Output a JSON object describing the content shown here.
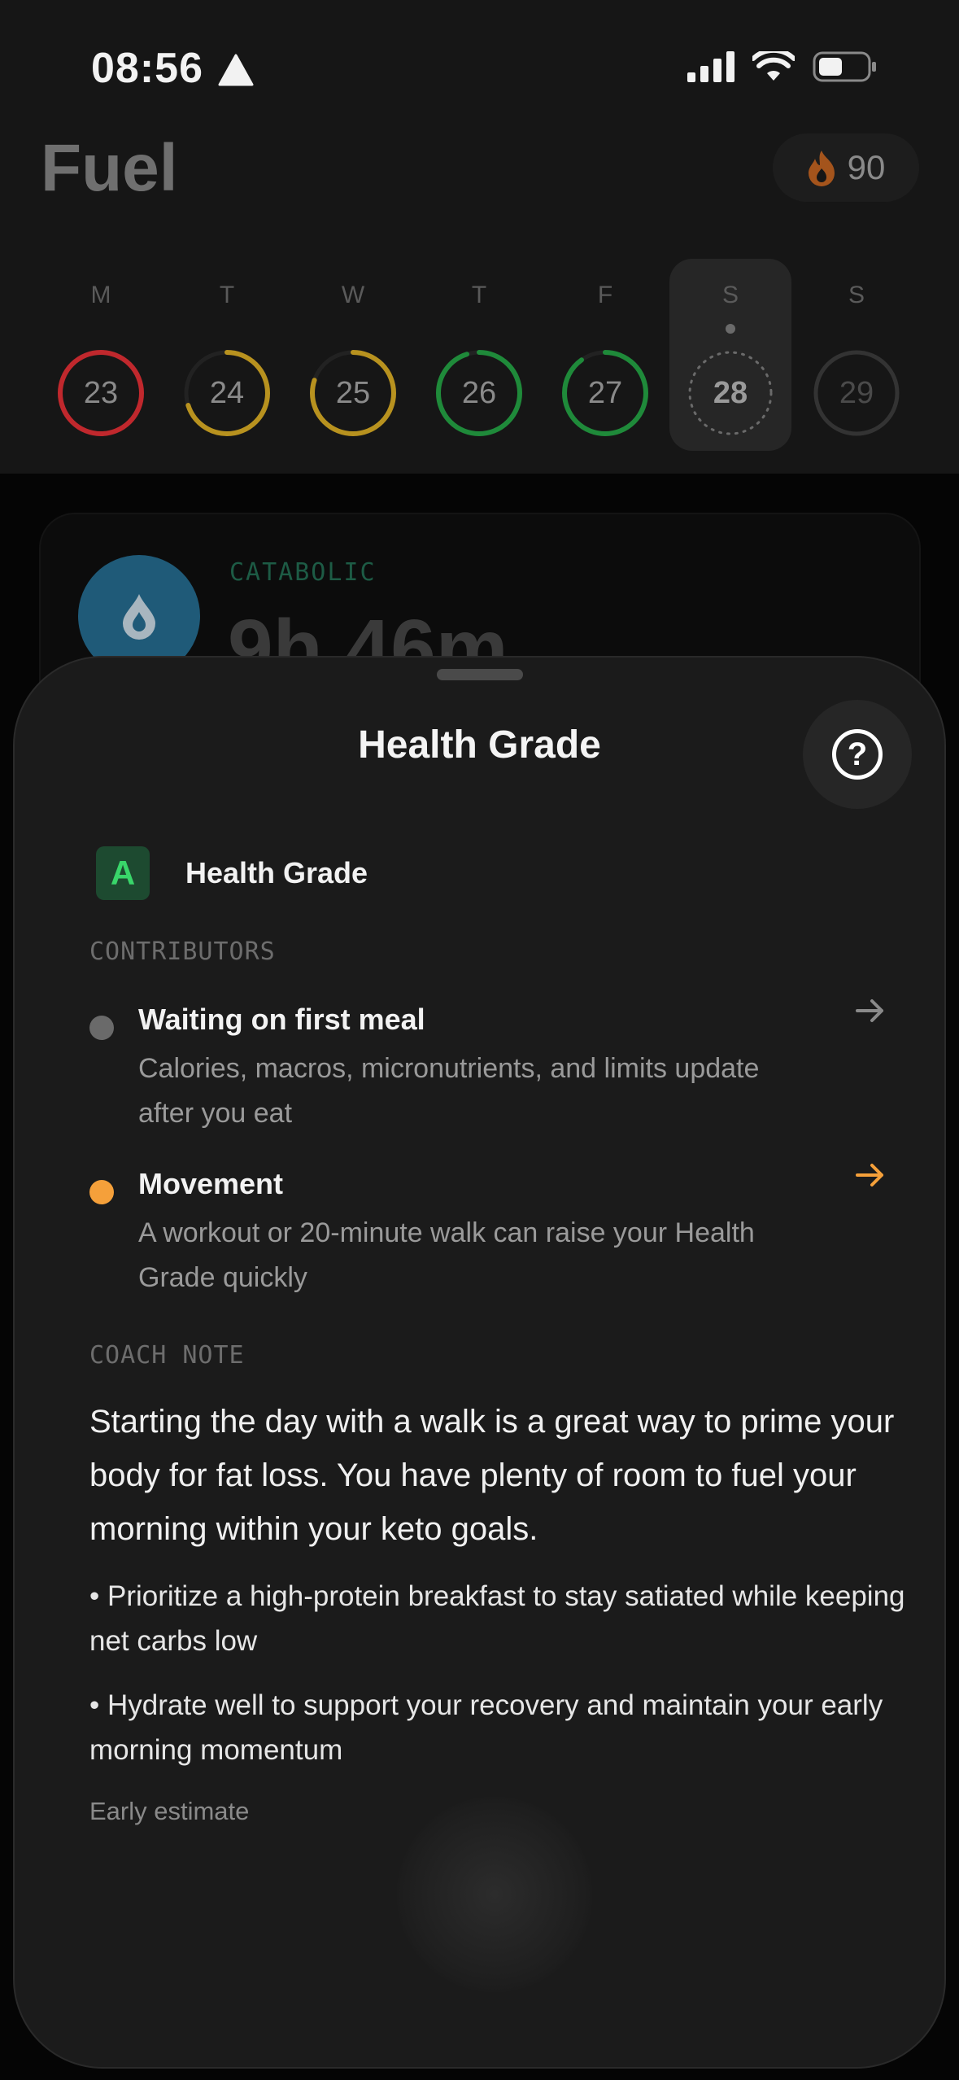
{
  "status_bar": {
    "time": "08:56"
  },
  "app": {
    "title": "Fuel",
    "streak_value": "90"
  },
  "week": [
    {
      "letter": "M",
      "day": "23",
      "ring_color": "#c0282d",
      "progress": 1.0
    },
    {
      "letter": "T",
      "day": "24",
      "ring_color": "#b8921f",
      "progress": 0.7
    },
    {
      "letter": "W",
      "day": "25",
      "ring_color": "#b8921f",
      "progress": 0.8
    },
    {
      "letter": "T",
      "day": "26",
      "ring_color": "#1f8a3a",
      "progress": 0.95
    },
    {
      "letter": "F",
      "day": "27",
      "ring_color": "#1f8a3a",
      "progress": 0.9
    },
    {
      "letter": "S",
      "day": "28",
      "ring_color": "#8a8a8a",
      "progress": 0,
      "selected": true
    },
    {
      "letter": "S",
      "day": "29",
      "ring_color": "#333333",
      "progress": 0
    }
  ],
  "fast_card": {
    "phase": "CATABOLIC",
    "elapsed": "9h 46m"
  },
  "sheet": {
    "title": "Health Grade",
    "grade_letter": "A",
    "grade_label": "Health Grade",
    "contributors_label": "CONTRIBUTORS",
    "contributors": [
      {
        "title": "Waiting on first meal",
        "description": "Calories, macros, micronutrients, and limits update after you eat",
        "dot_color": "#6a6a6a",
        "arrow_color": "#8a8a8a"
      },
      {
        "title": "Movement",
        "description": "A workout or 20-minute walk can raise your Health Grade quickly",
        "dot_color": "#f5a03a",
        "arrow_color": "#f5a03a"
      }
    ],
    "coach_label": "COACH NOTE",
    "coach_text": "Starting the day with a walk is a great way to prime your body for fat loss. You have plenty of room to fuel your morning within your keto goals.",
    "bullets": [
      "• Prioritize a high-protein breakfast to stay satiated while keeping net carbs low",
      "• Hydrate well to support your recovery and maintain your early morning momentum"
    ],
    "estimate_label": "Early estimate"
  }
}
